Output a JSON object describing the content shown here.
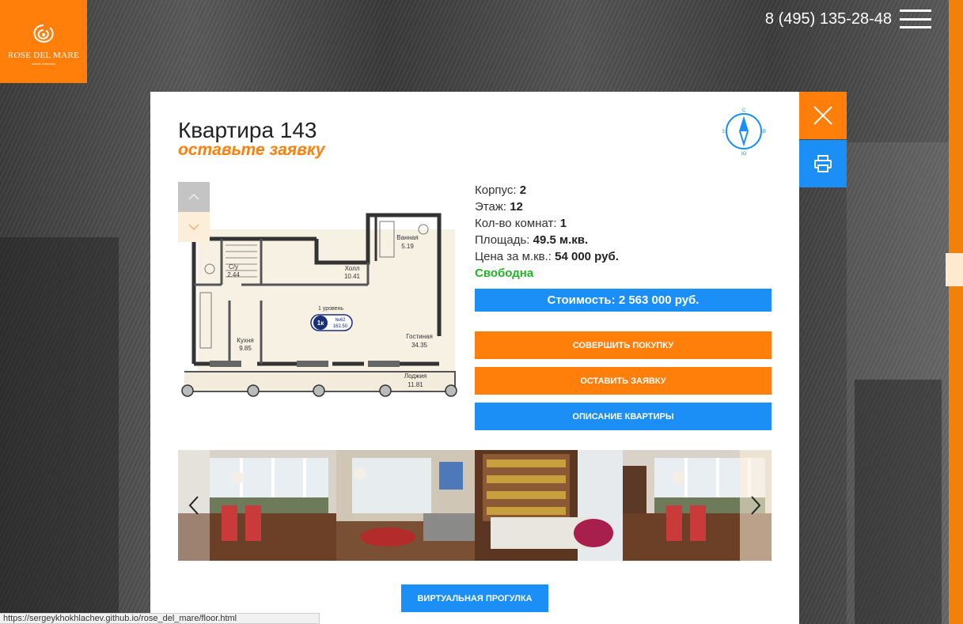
{
  "brand": {
    "name": "ROSE DEL MARE",
    "tagline": "жилой комплекс",
    "color": "#ff7f0a"
  },
  "header": {
    "phone": "8 (495) 135-28-48",
    "menu_icon": "hamburger-menu-icon"
  },
  "modal": {
    "title": "Квартира 143",
    "subtitle": "оставьте заявку",
    "close_icon": "close-icon",
    "print_icon": "printer-icon",
    "compass": {
      "north": "С",
      "east": "В",
      "south": "Ю",
      "west": "З"
    },
    "plan": {
      "level": "1 уровень",
      "badge": "1к",
      "badge_number": "№62",
      "badge_area": "162.50",
      "rooms": [
        {
          "name": "С/у",
          "area": "2.44"
        },
        {
          "name": "Ванная",
          "area": "5.19"
        },
        {
          "name": "Холл",
          "area": "10.41"
        },
        {
          "name": "Кухня",
          "area": "9.85"
        },
        {
          "name": "Гостиная",
          "area": "34.35"
        },
        {
          "name": "Лоджия",
          "area": "11.81"
        }
      ]
    },
    "info": {
      "building_label": "Корпус:",
      "building_value": "2",
      "floor_label": "Этаж:",
      "floor_value": "12",
      "rooms_label": "Кол-во комнат:",
      "rooms_value": "1",
      "area_label": "Площадь:",
      "area_value": "49.5 м.кв.",
      "price_sqm_label": "Цена за м.кв.:",
      "price_sqm_value": "54 000 руб.",
      "status": "Свободна"
    },
    "price_bar": {
      "label": "Стоимость:",
      "value": "2 563 000 руб."
    },
    "buttons": {
      "purchase": "СОВЕРШИТЬ ПОКУПКУ",
      "request": "ОСТАВИТЬ ЗАЯВКУ",
      "description": "ОПИСАНИЕ КВАРТИРЫ",
      "virtual_tour": "ВИРТУАЛЬНАЯ ПРОГУЛКА"
    }
  },
  "status_url": "https://sergeykhokhlachev.github.io/rose_del_mare/floor.html",
  "colors": {
    "orange": "#ff7f0a",
    "blue": "#1b8ff5",
    "green": "#25b12a"
  }
}
